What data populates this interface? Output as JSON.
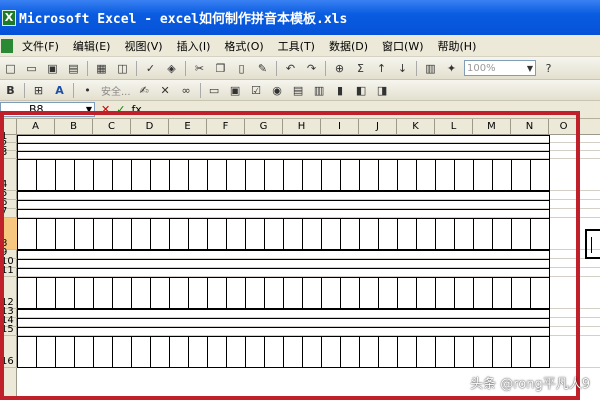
{
  "window": {
    "title": "Microsoft Excel - excel如何制作拼音本模板.xls"
  },
  "menu": {
    "items": [
      "文件(F)",
      "编辑(E)",
      "视图(V)",
      "插入(I)",
      "格式(O)",
      "工具(T)",
      "数据(D)",
      "窗口(W)",
      "帮助(H)"
    ]
  },
  "toolbar": {
    "zoom_value": "100%",
    "sigma": "Σ",
    "security_label": "安全..."
  },
  "formula_bar": {
    "name_box": "B8",
    "fx": "fx"
  },
  "sheet": {
    "columns": [
      "A",
      "B",
      "C",
      "D",
      "E",
      "F",
      "G",
      "H",
      "I",
      "J",
      "K",
      "L",
      "M",
      "N",
      "O"
    ],
    "rows": [
      "1",
      "2",
      "3",
      "4",
      "5",
      "6",
      "7",
      "8",
      "9",
      "10",
      "11",
      "12",
      "13",
      "14",
      "15",
      "16"
    ],
    "selected_row": "8",
    "highlight_color": "#c0202a"
  },
  "watermark": "头条 @rong平凡人9"
}
